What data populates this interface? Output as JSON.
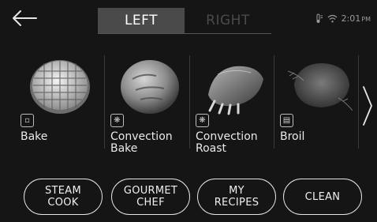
{
  "tabs": {
    "left": "LEFT",
    "right": "RIGHT"
  },
  "status": {
    "time": "2:01",
    "ampm": "PM"
  },
  "modes": [
    {
      "label": "Bake",
      "icon": "bake-mode-icon"
    },
    {
      "label": "Convection\nBake",
      "icon": "fan-icon"
    },
    {
      "label": "Convection\nRoast",
      "icon": "fan-roast-icon"
    },
    {
      "label": "Broil",
      "icon": "broil-icon"
    }
  ],
  "bottom": {
    "steam": "STEAM\nCOOK",
    "gourmet": "GOURMET\nCHEF",
    "recipes": "MY\nRECIPES",
    "clean": "CLEAN"
  },
  "colors": {
    "background": "#151515",
    "active_tab": "#4a4a4a",
    "inactive_tab_text": "#4a4a4a"
  }
}
